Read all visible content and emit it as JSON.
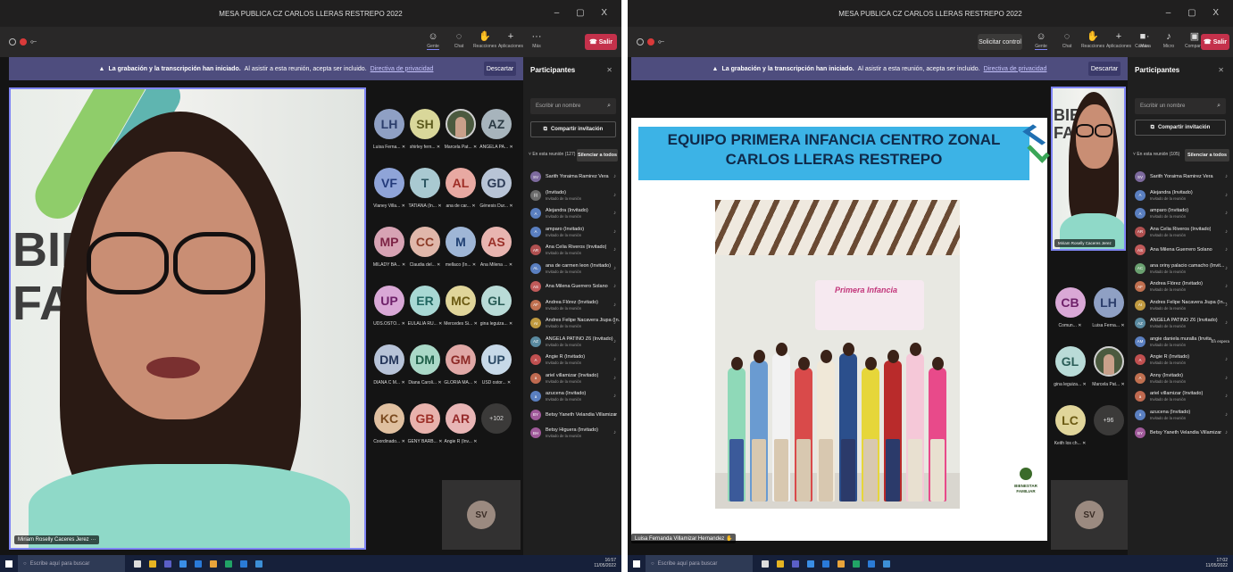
{
  "left": {
    "window_title": "MESA PUBLICA CZ CARLOS LLERAS RESTREPO 2022",
    "window_controls": "–  ▢  X",
    "toolbar": [
      {
        "label": "Gente",
        "icon": "people-icon",
        "glyph": "☺",
        "active": true
      },
      {
        "label": "Chat",
        "icon": "chat-icon",
        "glyph": "◌",
        "active": false
      },
      {
        "label": "Reacciones",
        "icon": "reactions-icon",
        "glyph": "✋",
        "active": false
      },
      {
        "label": "Aplicaciones",
        "icon": "apps-icon",
        "glyph": "+",
        "active": false
      },
      {
        "label": "Más",
        "icon": "more-icon",
        "glyph": "···",
        "active": false
      }
    ],
    "exit_label": "Salir",
    "banner": {
      "bold": "La grabación y la transcripción han iniciado.",
      "text": "Al asistir a esta reunión, acepta ser incluido.",
      "link": "Directiva de privacidad",
      "dismiss": "Descartar"
    },
    "speaker_name": "Miriam Roselly Caceres Jerez",
    "speaker_logo": [
      "BIE",
      "FA"
    ],
    "tiles": [
      {
        "initials": "LH",
        "bg": "#8fa0c4",
        "fg": "#2b3d6b",
        "label": "Luisa Ferna..."
      },
      {
        "initials": "SH",
        "bg": "#d9d79a",
        "fg": "#5d5b1e",
        "label": "shirley fern..."
      },
      {
        "initials": "",
        "bg": "#4b5a3f",
        "fg": "#fff",
        "label": "Marcela Pat...",
        "photo": true
      },
      {
        "initials": "AZ",
        "bg": "#a7b4bc",
        "fg": "#2b3a44",
        "label": "ANGELA PA..."
      },
      {
        "initials": "VF",
        "bg": "#8fa4d8",
        "fg": "#233a7a",
        "label": "Vianey Villa..."
      },
      {
        "initials": "T",
        "bg": "#a9c9d1",
        "fg": "#2c5560",
        "label": "TATIANA (In..."
      },
      {
        "initials": "AL",
        "bg": "#e8a9a2",
        "fg": "#9e2d25",
        "label": "ana de car..."
      },
      {
        "initials": "GD",
        "bg": "#b8c4d6",
        "fg": "#2b3a55",
        "label": "Génesis Dur..."
      },
      {
        "initials": "MP",
        "bg": "#d7a3b4",
        "fg": "#7c2345",
        "label": "MILADY BA..."
      },
      {
        "initials": "CC",
        "bg": "#e0b7aa",
        "fg": "#8c3c28",
        "label": "Claudia del..."
      },
      {
        "initials": "M",
        "bg": "#9fb6d6",
        "fg": "#1f3f72",
        "label": "mellaco (In..."
      },
      {
        "initials": "AS",
        "bg": "#e8b5b0",
        "fg": "#9a3029",
        "label": "Ana Milena ..."
      },
      {
        "initials": "UP",
        "bg": "#d9a8d6",
        "fg": "#6e2169",
        "label": "UDS.OSTO..."
      },
      {
        "initials": "ER",
        "bg": "#a8d8d4",
        "fg": "#1f6560",
        "label": "EULALIA RU..."
      },
      {
        "initials": "MC",
        "bg": "#e0d59a",
        "fg": "#6b5a12",
        "label": "Mercedes Si..."
      },
      {
        "initials": "GL",
        "bg": "#b9dbd7",
        "fg": "#2a5d57",
        "label": "gina leguiza..."
      },
      {
        "initials": "DM",
        "bg": "#b7c3d8",
        "fg": "#24355a",
        "label": "DIANA C M..."
      },
      {
        "initials": "DM",
        "bg": "#a9d8c7",
        "fg": "#1e5e48",
        "label": "Diana Caroli..."
      },
      {
        "initials": "GM",
        "bg": "#e0a8a6",
        "fg": "#8c2a26",
        "label": "GLORIA MA..."
      },
      {
        "initials": "UP",
        "bg": "#c7d9e8",
        "fg": "#2c4a66",
        "label": "USD ostor..."
      },
      {
        "initials": "KC",
        "bg": "#e0c0a0",
        "fg": "#7a4a1e",
        "label": "Coordinado..."
      },
      {
        "initials": "GB",
        "bg": "#e8b2ac",
        "fg": "#9c2f27",
        "label": "GENY BARB..."
      },
      {
        "initials": "AR",
        "bg": "#e8b5b5",
        "fg": "#962b2b",
        "label": "Angie R (Inv..."
      },
      {
        "initials": "+102",
        "bg": "#3b3a39",
        "fg": "#ddd",
        "label": "",
        "more": true
      }
    ],
    "self_initials": "SV",
    "panel": {
      "title": "Participantes",
      "search_placeholder": "Escribir un nombre",
      "invite": "Compartir invitación",
      "section": "En esta reunión (127)",
      "mute_all": "Silenciar a todos",
      "people": [
        {
          "initials": "SV",
          "name": "Sarith Yoraima Ramirez Vera",
          "sub": "",
          "bg": "#7d6a9e"
        },
        {
          "initials": "(I)",
          "name": "(Invitado)",
          "sub": "Invitado de la reunión",
          "bg": "#6b6b6b"
        },
        {
          "initials": "A",
          "name": "Alejandra (Invitado)",
          "sub": "Invitado de la reunión",
          "bg": "#5a7fc0"
        },
        {
          "initials": "A",
          "name": "amparo (Invitado)",
          "sub": "Invitado de la reunión",
          "bg": "#5a7fc0"
        },
        {
          "initials": "AR",
          "name": "Ana Celia Riveros (Invitado)",
          "sub": "Invitado de la reunión",
          "bg": "#b05050"
        },
        {
          "initials": "AL",
          "name": "ana de carmen leon (Invitado)",
          "sub": "Invitado de la reunión",
          "bg": "#5a7fc0"
        },
        {
          "initials": "AS",
          "name": "Ana Milena Guerrero Solano",
          "sub": "",
          "bg": "#c05a5a"
        },
        {
          "initials": "AF",
          "name": "Andrea Flórez (Invitado)",
          "sub": "Invitado de la reunión",
          "bg": "#c07050"
        },
        {
          "initials": "AI",
          "name": "Andres Felipe Nacavera Jiupa (In...",
          "sub": "Invitado de la reunión",
          "bg": "#c09a40"
        },
        {
          "initials": "AZ",
          "name": "ANGELA PATIÑO Z6 (Invitado)",
          "sub": "Invitado de la reunión",
          "bg": "#5a8aa0"
        },
        {
          "initials": "A",
          "name": "Angie R (Invitado)",
          "sub": "Invitado de la reunión",
          "bg": "#c05050"
        },
        {
          "initials": "a",
          "name": "ariel villamizar (Invitado)",
          "sub": "Invitado de la reunión",
          "bg": "#c06a50"
        },
        {
          "initials": "a",
          "name": "azucena (Invitado)",
          "sub": "Invitado de la reunión",
          "bg": "#5a7fc0"
        },
        {
          "initials": "BY",
          "name": "Betsy Yaneth Velandia Villamizar",
          "sub": "",
          "bg": "#a05a9a"
        },
        {
          "initials": "BH",
          "name": "Betsy Higuera (Invitado)",
          "sub": "Invitado de la reunión",
          "bg": "#a05a9a"
        }
      ]
    },
    "taskbar": {
      "search": "Escribe aquí para buscar",
      "time": "16:57",
      "date": "11/05/2022"
    }
  },
  "right": {
    "window_title": "MESA PUBLICA CZ CARLOS LLERAS RESTREPO 2022",
    "window_controls": "–  ▢  X",
    "control_label": "Solicitar control",
    "toolbar": [
      {
        "label": "Gente",
        "icon": "people-icon",
        "glyph": "☺",
        "active": true
      },
      {
        "label": "Chat",
        "icon": "chat-icon",
        "glyph": "◌",
        "active": false
      },
      {
        "label": "Reacciones",
        "icon": "reactions-icon",
        "glyph": "✋",
        "active": false
      },
      {
        "label": "Aplicaciones",
        "icon": "apps-icon",
        "glyph": "+",
        "active": false
      },
      {
        "label": "Más",
        "icon": "more-icon",
        "glyph": "···",
        "active": false
      }
    ],
    "devices": [
      {
        "label": "Cámara",
        "icon": "camera-icon",
        "glyph": "■"
      },
      {
        "label": "Micro",
        "icon": "mic-icon",
        "glyph": "♪"
      },
      {
        "label": "Compartir",
        "icon": "share-icon",
        "glyph": "▣"
      }
    ],
    "exit_label": "Salir",
    "banner": {
      "bold": "La grabación y la transcripción han iniciado.",
      "text": "Al asistir a esta reunión, acepta ser incluido.",
      "link": "Directiva de privacidad",
      "dismiss": "Descartar"
    },
    "slide_title": "EQUIPO PRIMERA INFANCIA CENTRO ZONAL CARLOS LLERAS RESTREPO",
    "slide_sign": "Primera Infancia",
    "slide_footer_logo": "BIENESTAR FAMILIAR",
    "presenter": "Luisa Fernanda Villamizar Hernandez",
    "speaker_name": "Miriam Roselly Caceres Jerez",
    "speaker_logo": [
      "BIE",
      "FA"
    ],
    "tiles": [
      {
        "initials": "CB",
        "bg": "#d9a8d6",
        "fg": "#6e2169",
        "label": "Comun..."
      },
      {
        "initials": "LH",
        "bg": "#8fa0c4",
        "fg": "#2b3d6b",
        "label": "Luisa Ferna..."
      },
      {
        "initials": "GL",
        "bg": "#b9dbd7",
        "fg": "#2a5d57",
        "label": "gina leguiza..."
      },
      {
        "initials": "",
        "bg": "#4b5a3f",
        "fg": "#fff",
        "label": "Marcela Pat...",
        "photo": true
      },
      {
        "initials": "LC",
        "bg": "#e0d59a",
        "fg": "#6b5a12",
        "label": "Keith los ch..."
      },
      {
        "initials": "+96",
        "bg": "#3b3a39",
        "fg": "#ddd",
        "label": "",
        "more": true
      }
    ],
    "self_initials": "SV",
    "panel": {
      "title": "Participantes",
      "search_placeholder": "Escribir un nombre",
      "invite": "Compartir invitación",
      "section": "En esta reunión (105)",
      "mute_all": "Silenciar a todos",
      "people": [
        {
          "initials": "SV",
          "name": "Sarith Yoraima Ramirez Vera",
          "sub": "",
          "bg": "#7d6a9e"
        },
        {
          "initials": "A",
          "name": "Alejandra (Invitado)",
          "sub": "Invitado de la reunión",
          "bg": "#5a7fc0"
        },
        {
          "initials": "A",
          "name": "amparo (Invitado)",
          "sub": "Invitado de la reunión",
          "bg": "#5a7fc0"
        },
        {
          "initials": "AR",
          "name": "Ana Celia Riveros (Invitado)",
          "sub": "Invitado de la reunión",
          "bg": "#b05050"
        },
        {
          "initials": "AS",
          "name": "Ana Milena Guerrero Solano",
          "sub": "",
          "bg": "#c05a5a"
        },
        {
          "initials": "AC",
          "name": "ana oriny palacio camacho (Invit...",
          "sub": "Invitado de la reunión",
          "bg": "#6aa070"
        },
        {
          "initials": "AF",
          "name": "Andrea Flórez (Invitado)",
          "sub": "Invitado de la reunión",
          "bg": "#c07050"
        },
        {
          "initials": "AI",
          "name": "Andres Felipe Nacavera Jiupa (In...",
          "sub": "Invitado de la reunión",
          "bg": "#c09a40"
        },
        {
          "initials": "AZ",
          "name": "ANGELA PATIÑO Z6 (Invitado)",
          "sub": "Invitado de la reunión",
          "bg": "#5a8aa0"
        },
        {
          "initials": "AM",
          "name": "angie daniela muralla (Invita...",
          "sub": "Invitado de la reunión",
          "bg": "#5a7fc0",
          "extra": "En espera"
        },
        {
          "initials": "A",
          "name": "Angie R (Invitado)",
          "sub": "Invitado de la reunión",
          "bg": "#c05050"
        },
        {
          "initials": "A",
          "name": "Anny (Invitado)",
          "sub": "Invitado de la reunión",
          "bg": "#c07050"
        },
        {
          "initials": "a",
          "name": "ariel villamizar (Invitado)",
          "sub": "Invitado de la reunión",
          "bg": "#c06a50"
        },
        {
          "initials": "a",
          "name": "azucena (Invitado)",
          "sub": "Invitado de la reunión",
          "bg": "#5a7fc0"
        },
        {
          "initials": "BY",
          "name": "Betsy Yaneth Velandia Villamizar",
          "sub": "",
          "bg": "#a05a9a"
        }
      ]
    },
    "taskbar": {
      "search": "Escribe aquí para buscar",
      "time": "17:02",
      "date": "11/05/2022"
    }
  }
}
